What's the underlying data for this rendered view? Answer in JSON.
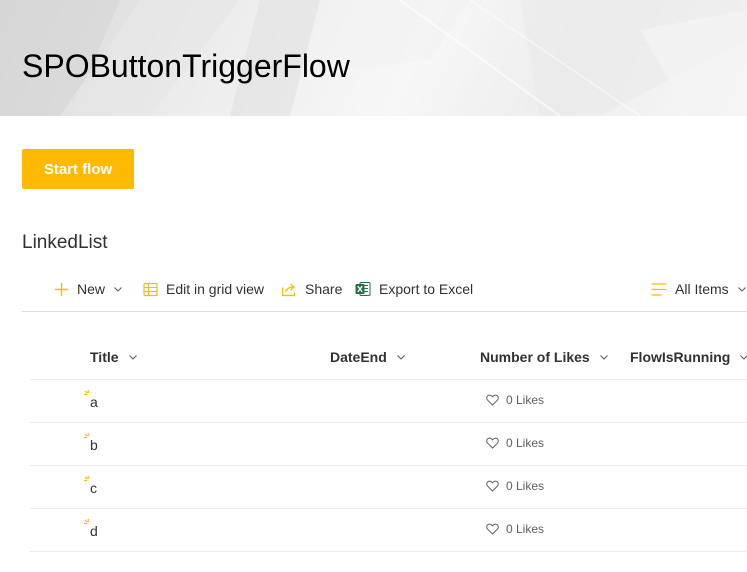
{
  "header": {
    "title": "SPOButtonTriggerFlow"
  },
  "actions": {
    "start_flow_label": "Start flow"
  },
  "list": {
    "title": "LinkedList"
  },
  "commands": {
    "new_label": "New",
    "edit_grid_label": "Edit in grid view",
    "share_label": "Share",
    "export_label": "Export to Excel",
    "view_label": "All Items"
  },
  "columns": {
    "title": "Title",
    "date_end": "DateEnd",
    "likes": "Number of Likes",
    "flow_running": "FlowIsRunning"
  },
  "rows": [
    {
      "title": "a",
      "likes": "0 Likes"
    },
    {
      "title": "b",
      "likes": "0 Likes"
    },
    {
      "title": "c",
      "likes": "0 Likes"
    },
    {
      "title": "d",
      "likes": "0 Likes"
    }
  ],
  "colors": {
    "accent": "#ffb900",
    "excel_green": "#217346",
    "text": "#323130",
    "divider": "#edebe9"
  }
}
